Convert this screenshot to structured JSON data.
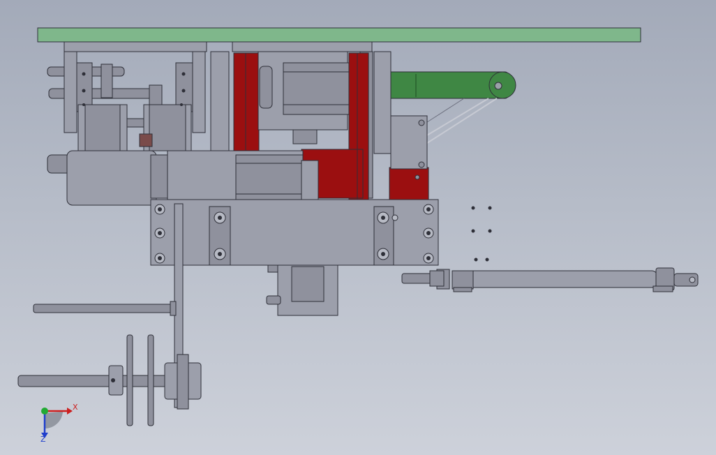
{
  "colors": {
    "background_top": "#a3aab9",
    "background_bottom": "#cdd1da",
    "part_gray": "#8f919d",
    "part_gray_light": "#9c9fab",
    "outline": "#2e2f38",
    "frame_red": "#9b0f10",
    "plate_green_light": "#7fb78b",
    "arm_green": "#3f8744",
    "axis_x": "#cc1f1f",
    "axis_y": "#22aa33",
    "axis_z": "#1f3ecc"
  },
  "axis_triad": {
    "x_label": "X",
    "z_label": "Z"
  },
  "parts": {
    "top_plate": "top-mounting-plate",
    "red_frame": "red-side-frame",
    "green_arm": "green-swing-arm",
    "motor_upper": "servo-motor-upper",
    "motor_left": "cylinder-motor-left",
    "base_block": "main-base-block",
    "long_cylinder": "pneumatic-cylinder-right",
    "pulley_shaft": "pulley-shaft-assembly",
    "lower_actuator": "lower-slide-actuator"
  }
}
